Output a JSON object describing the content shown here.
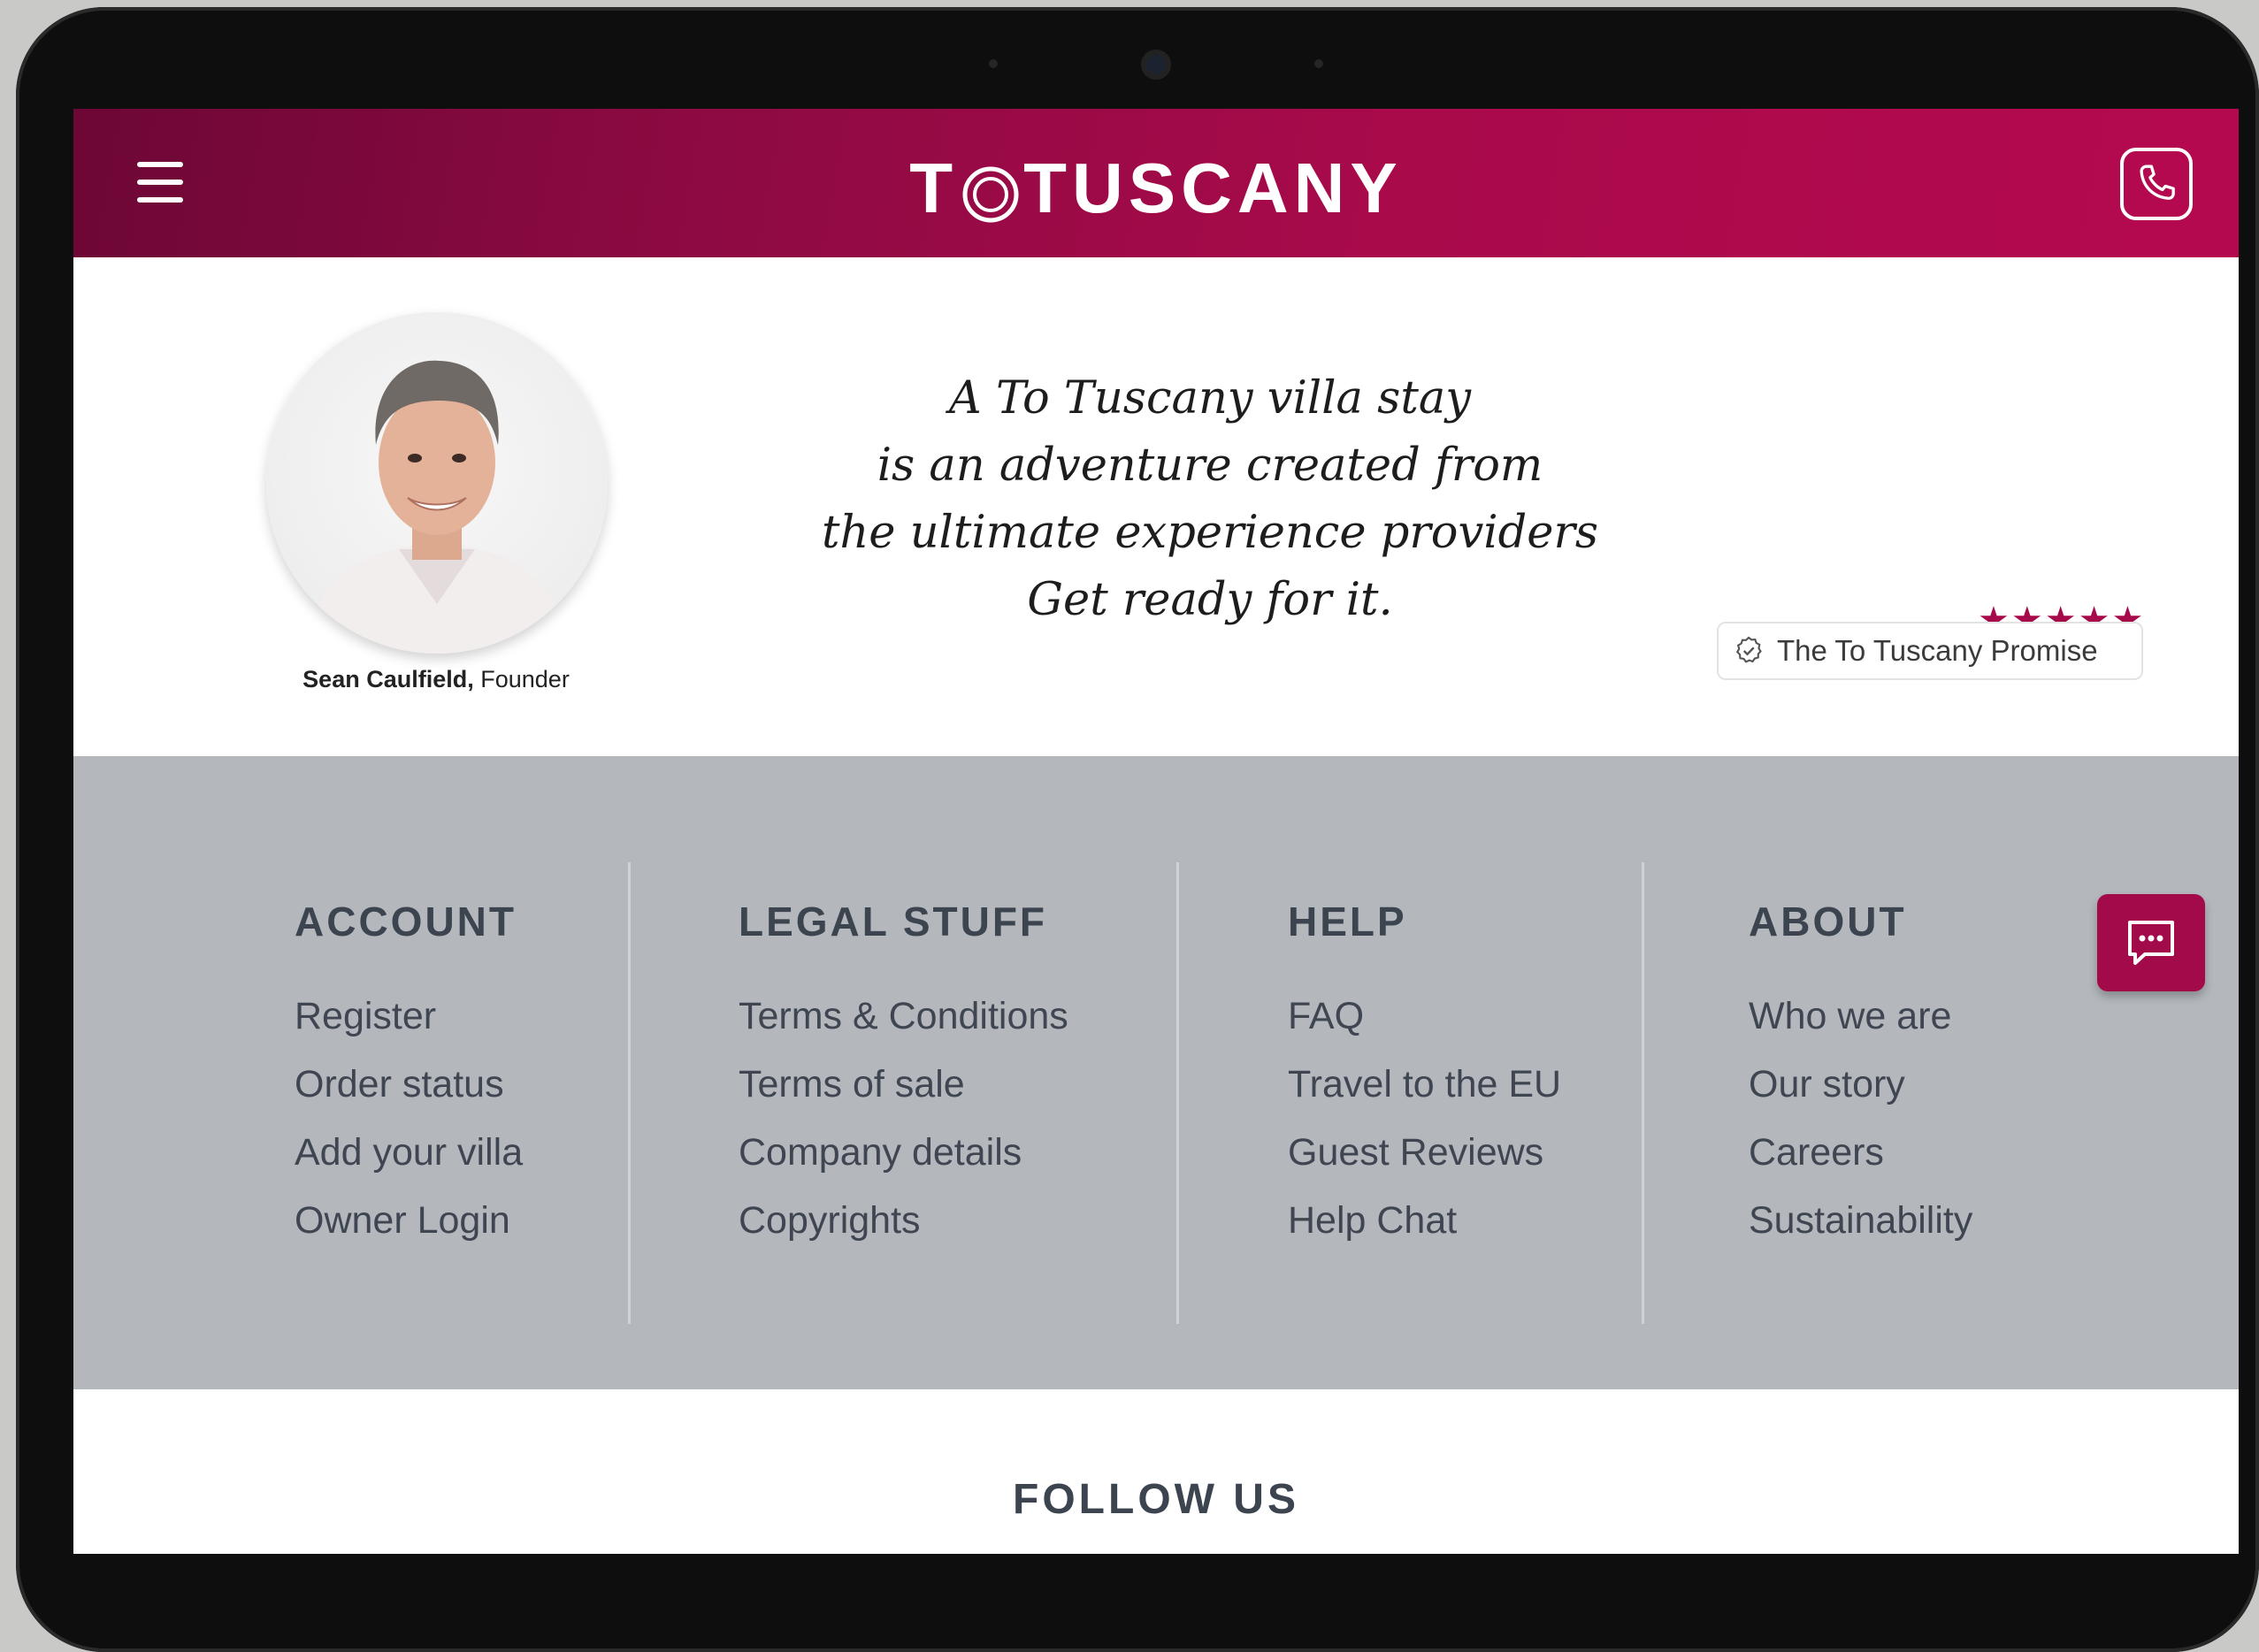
{
  "header": {
    "logo_prefix": "T",
    "logo_suffix": "TUSCANY",
    "menu_icon": "hamburger-icon",
    "phone_icon": "phone-icon"
  },
  "hero": {
    "founder_name": "Sean Caulfield,",
    "founder_role": "Founder",
    "quote_lines": [
      "A To Tuscany villa stay",
      "is an adventure created from",
      "the ultimate experience providers",
      "Get ready for it."
    ],
    "stars": "★★★★★",
    "promise_label": "The To Tuscany Promise"
  },
  "footer": {
    "columns": [
      {
        "heading": "ACCOUNT",
        "links": [
          "Register",
          "Order status",
          "Add your villa",
          "Owner Login"
        ]
      },
      {
        "heading": "LEGAL STUFF",
        "links": [
          "Terms & Conditions",
          "Terms of sale",
          "Company details",
          "Copyrights"
        ]
      },
      {
        "heading": "HELP",
        "links": [
          "FAQ",
          "Travel to the EU",
          "Guest Reviews",
          "Help Chat"
        ]
      },
      {
        "heading": "ABOUT",
        "links": [
          "Who we are",
          "Our story",
          "Careers",
          "Sustainability"
        ]
      }
    ]
  },
  "follow_us": "FOLLOW US",
  "colors": {
    "brand": "#a80a4a",
    "footer_bg": "#b4b8bd",
    "text_dark": "#3c4450"
  }
}
